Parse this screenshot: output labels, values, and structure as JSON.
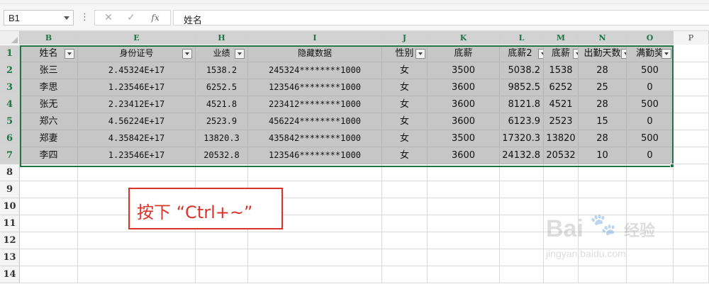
{
  "formula_bar": {
    "name_box": "B1",
    "separator": "⋮",
    "cancel": "✕",
    "enter": "✓",
    "fx": "fx",
    "formula": "姓名"
  },
  "columns": [
    "B",
    "E",
    "H",
    "I",
    "J",
    "K",
    "L",
    "M",
    "N",
    "O",
    "P"
  ],
  "rows": [
    "1",
    "2",
    "3",
    "4",
    "5",
    "6",
    "7",
    "8",
    "9",
    "10",
    "11",
    "12",
    "13",
    "14"
  ],
  "headers": [
    "姓名",
    "身份证号",
    "业绩",
    "隐藏数据",
    "性别",
    "底薪",
    "底薪2",
    "底薪",
    "出勤天数",
    "满勤奖"
  ],
  "table": [
    [
      "张三",
      "2.45324E+17",
      "1538.2",
      "245324********1000",
      "女",
      "3500",
      "5038.2",
      "1538",
      "28",
      "500"
    ],
    [
      "李思",
      "1.23546E+17",
      "6252.5",
      "123546********1000",
      "女",
      "3600",
      "9852.5",
      "6252",
      "25",
      "0"
    ],
    [
      "张无",
      "2.23412E+17",
      "4521.8",
      "223412********1000",
      "女",
      "3600",
      "8121.8",
      "4521",
      "28",
      "500"
    ],
    [
      "郑六",
      "4.56224E+17",
      "2523.9",
      "456224********1000",
      "女",
      "3600",
      "6123.9",
      "2523",
      "15",
      "0"
    ],
    [
      "郑妻",
      "4.35842E+17",
      "13820.3",
      "435842********1000",
      "女",
      "3500",
      "17320.3",
      "13820",
      "28",
      "500"
    ],
    [
      "李四",
      "1.23546E+17",
      "20532.8",
      "123546********1000",
      "女",
      "3600",
      "24132.8",
      "20532",
      "10",
      "0"
    ]
  ],
  "annotation": "按下 “Ctrl+~”",
  "watermark": {
    "logo": "Bai",
    "paw": "🐾",
    "brand": "经验",
    "url": "jingyan.baidu.com"
  },
  "colors": {
    "selection_border": "#217346",
    "selected_fill": "#c6c6c6",
    "annotation_red": "#d9342b"
  }
}
